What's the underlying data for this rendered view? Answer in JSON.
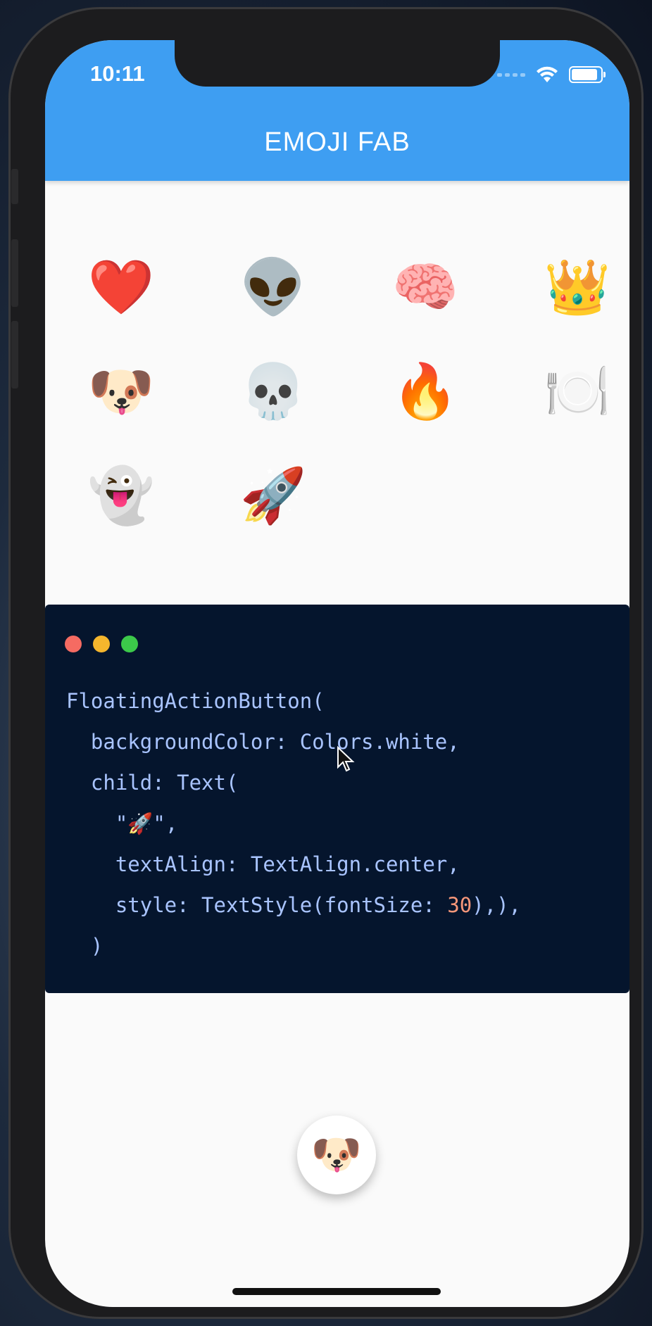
{
  "status_bar": {
    "time": "10:11"
  },
  "app_bar": {
    "title": "EMOJI FAB"
  },
  "emoji_grid": [
    {
      "name": "heart",
      "emoji": "❤️"
    },
    {
      "name": "alien",
      "emoji": "👽"
    },
    {
      "name": "brain",
      "emoji": "🧠"
    },
    {
      "name": "crown",
      "emoji": "👑"
    },
    {
      "name": "dog",
      "emoji": "🐶"
    },
    {
      "name": "skull",
      "emoji": "💀"
    },
    {
      "name": "fire",
      "emoji": "🔥"
    },
    {
      "name": "plate",
      "emoji": "🍽️"
    },
    {
      "name": "ghost",
      "emoji": "👻"
    },
    {
      "name": "rocket",
      "emoji": "🚀"
    }
  ],
  "code_card": {
    "window_dots": [
      "#f56b62",
      "#f5b62d",
      "#3cc94a"
    ],
    "lines": [
      "FloatingActionButton(",
      "  backgroundColor: Colors.white,",
      "  child: Text(",
      "    \"🚀\",",
      "    textAlign: TextAlign.center,",
      "    style: TextStyle(fontSize: 30),),",
      "  )"
    ]
  },
  "fab": {
    "emoji": "🐶"
  },
  "colors": {
    "app_bar": "#3e9ef2",
    "code_bg": "#05152d",
    "code_text": "#a9c4ff",
    "code_number": "#f7977a"
  }
}
